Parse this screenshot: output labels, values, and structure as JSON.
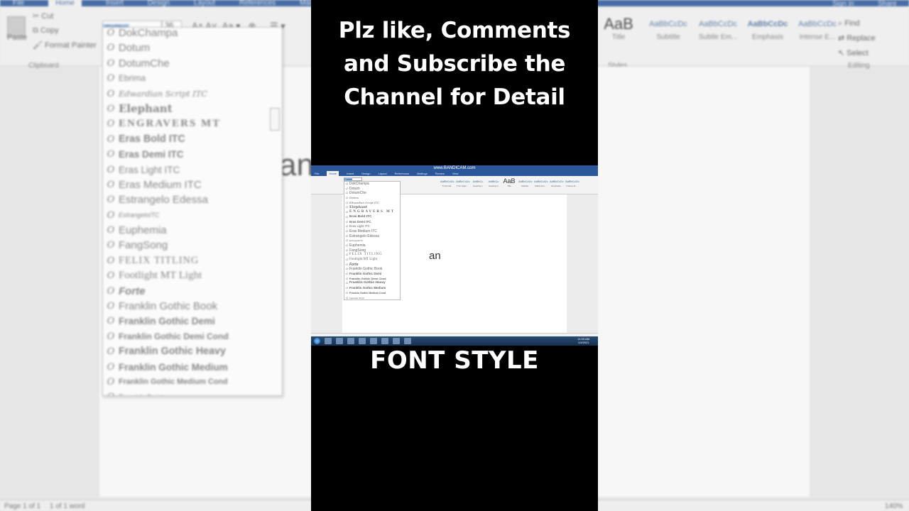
{
  "background": {
    "tabs": [
      "File",
      "Home",
      "Insert",
      "Design",
      "Layout",
      "References",
      "Mailings"
    ],
    "clipboard": {
      "paste": "Paste",
      "cut": "Cut",
      "copy": "Copy",
      "format_painter": "Format Painter",
      "group": "Clipboard"
    },
    "font_box": "Calibri",
    "size_box": "36",
    "styles": [
      {
        "sample": "AaB",
        "label": "Title"
      },
      {
        "sample": "AaBbCcDc",
        "label": "Subtitle"
      },
      {
        "sample": "AaBbCcDc",
        "label": "Subtle Em..."
      },
      {
        "sample": "AaBbCcDc",
        "label": "Emphasis"
      },
      {
        "sample": "AaBbCcDc",
        "label": "Intense E..."
      }
    ],
    "styles_group": "Styles",
    "editing": {
      "find": "Find",
      "replace": "Replace",
      "select": "Select",
      "group": "Editing",
      "sign_in": "Sign in",
      "share": "Share"
    },
    "doc_text": "an",
    "status": {
      "page": "Page 1 of 1",
      "words": "1 of 1 word",
      "zoom": "140%"
    },
    "font_list": [
      {
        "name": "DokChampa",
        "style": "normal"
      },
      {
        "name": "Dotum",
        "style": "normal"
      },
      {
        "name": "DotumChe",
        "style": "normal"
      },
      {
        "name": "Ebrima",
        "style": "small"
      },
      {
        "name": "Edwardian Script ITC",
        "style": "script"
      },
      {
        "name": "Elephant",
        "style": "bold-serif"
      },
      {
        "name": "ENGRAVERS MT",
        "style": "engravers"
      },
      {
        "name": "Eras Bold ITC",
        "style": "bold"
      },
      {
        "name": "Eras Demi ITC",
        "style": "semibold"
      },
      {
        "name": "Eras Light ITC",
        "style": "light"
      },
      {
        "name": "Eras Medium ITC",
        "style": "normal"
      },
      {
        "name": "Estrangelo Edessa",
        "style": "normal"
      },
      {
        "name": "EstrangeloITC",
        "style": "tiny"
      },
      {
        "name": "Euphemia",
        "style": "normal"
      },
      {
        "name": "FangSong",
        "style": "normal"
      },
      {
        "name": "FELIX TITLING",
        "style": "caps"
      },
      {
        "name": "Footlight MT Light",
        "style": "serif-light"
      },
      {
        "name": "Forte",
        "style": "italic-bold"
      },
      {
        "name": "Franklin Gothic Book",
        "style": "normal"
      },
      {
        "name": "Franklin Gothic Demi",
        "style": "semibold"
      },
      {
        "name": "Franklin Gothic Demi Cond",
        "style": "cond-bold"
      },
      {
        "name": "Franklin Gothic Heavy",
        "style": "bold"
      },
      {
        "name": "Franklin Gothic Medium",
        "style": "semibold"
      },
      {
        "name": "Franklin Gothic Medium Cond",
        "style": "cond"
      },
      {
        "name": "Freestyle Script",
        "style": "tiny"
      }
    ]
  },
  "overlay": {
    "headline_lines": [
      "Plz like, Comments",
      "and Subscribe the",
      "Channel for Detail"
    ],
    "caption": "FONT STYLE"
  },
  "mini_screen": {
    "title": "www.BANDICAM.com",
    "tabs": [
      "File",
      "Home",
      "Insert",
      "Design",
      "Layout",
      "References",
      "Mailings",
      "Review",
      "View"
    ],
    "doc_text": "an",
    "font_box": "Calibri",
    "styles": [
      {
        "sample": "AaBbCcDc",
        "label": "¶ Normal"
      },
      {
        "sample": "AaBbCcDc",
        "label": "¶ No Spac..."
      },
      {
        "sample": "AaBbCc",
        "label": "Heading 1"
      },
      {
        "sample": "AaBbCc",
        "label": "Heading 2"
      },
      {
        "sample": "AaB",
        "label": "Title"
      },
      {
        "sample": "AaBbCcDc",
        "label": "Subtitle"
      },
      {
        "sample": "AaBbCcDc",
        "label": "Subtle Em..."
      },
      {
        "sample": "AaBbCcDc",
        "label": "Emphasis"
      },
      {
        "sample": "AaBbCcDc",
        "label": "Intense E..."
      }
    ],
    "clock": {
      "time": "11:03 AM",
      "date": "1/3/2021"
    }
  }
}
